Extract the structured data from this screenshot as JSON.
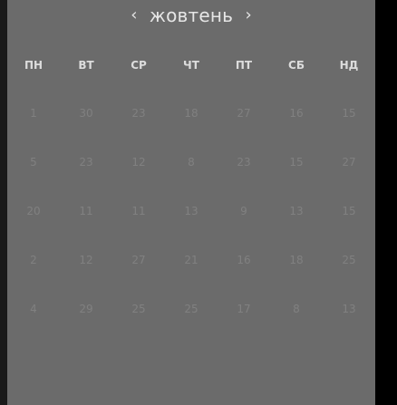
{
  "calendar": {
    "month_title": "жовтень",
    "prev_icon": "chevron-left-icon",
    "next_icon": "chevron-right-icon",
    "prev_glyph": "‹",
    "next_glyph": "›",
    "weekdays": [
      "ПН",
      "ВТ",
      "СР",
      "ЧТ",
      "ПТ",
      "СБ",
      "НД"
    ],
    "weeks": [
      [
        "1",
        "30",
        "23",
        "18",
        "27",
        "16",
        "15"
      ],
      [
        "5",
        "23",
        "12",
        "8",
        "23",
        "15",
        "27"
      ],
      [
        "20",
        "11",
        "11",
        "13",
        "9",
        "13",
        "15"
      ],
      [
        "2",
        "12",
        "27",
        "21",
        "16",
        "18",
        "25"
      ],
      [
        "4",
        "29",
        "25",
        "25",
        "17",
        "8",
        "13"
      ]
    ]
  },
  "colors": {
    "panel_background": "#6b6b6b",
    "outer_background": "#000000",
    "header_text": "#e6e6e6",
    "weekday_text": "#dcdcdc",
    "day_text": "#808080"
  }
}
